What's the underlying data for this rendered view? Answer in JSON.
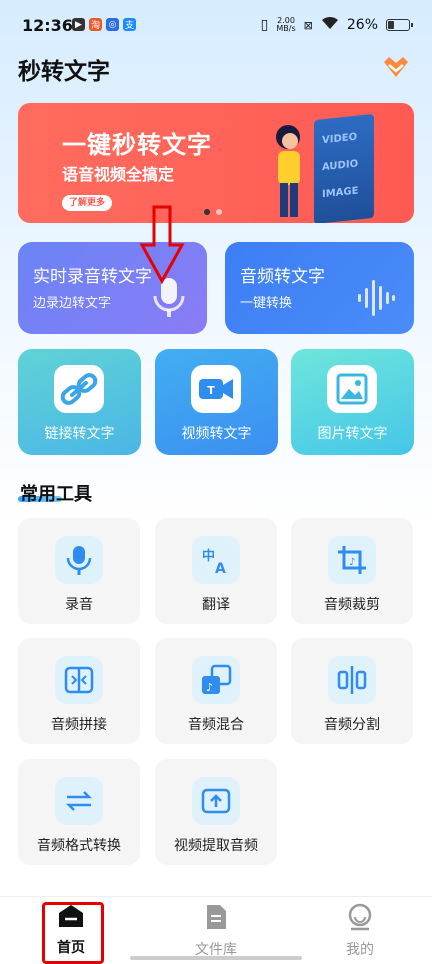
{
  "status_bar": {
    "time": "12:36",
    "speed_value": "2.00",
    "speed_unit": "MB/s",
    "battery": "26%"
  },
  "header": {
    "title": "秒转文字",
    "vip_icon": "diamond-crown-icon"
  },
  "banner": {
    "title": "一键秒转文字",
    "subtitle": "语音视频全搞定",
    "button": "了解更多",
    "book_words": [
      "VIDEO",
      "AUDIO",
      "IMAGE"
    ],
    "page_index": 1,
    "page_count": 2
  },
  "main_cards": [
    {
      "title": "实时录音转文字",
      "subtitle": "边录边转文字",
      "icon": "microphone-icon"
    },
    {
      "title": "音频转文字",
      "subtitle": "一键转换",
      "icon": "waveform-icon"
    }
  ],
  "secondary_cards": [
    {
      "label": "链接转文字",
      "icon": "link-icon"
    },
    {
      "label": "视频转文字",
      "icon": "video-icon"
    },
    {
      "label": "图片转文字",
      "icon": "image-icon"
    }
  ],
  "tools_section": {
    "title": "常用工具",
    "items": [
      {
        "label": "录音",
        "icon": "microphone-icon"
      },
      {
        "label": "翻译",
        "icon": "translate-icon"
      },
      {
        "label": "音频裁剪",
        "icon": "crop-icon"
      },
      {
        "label": "音频拼接",
        "icon": "audio-join-icon"
      },
      {
        "label": "音频混合",
        "icon": "audio-mix-icon"
      },
      {
        "label": "音频分割",
        "icon": "audio-split-icon"
      },
      {
        "label": "音频格式转换",
        "icon": "format-convert-icon"
      },
      {
        "label": "视频提取音频",
        "icon": "video-extract-audio-icon"
      }
    ]
  },
  "bottom_nav": [
    {
      "label": "首页",
      "icon": "home-icon",
      "active": true
    },
    {
      "label": "文件库",
      "icon": "file-icon",
      "active": false
    },
    {
      "label": "我的",
      "icon": "profile-icon",
      "active": false
    }
  ],
  "colors": {
    "accent": "#3d7ef5",
    "banner": "#ff5a54",
    "annotation": "#e60000"
  }
}
